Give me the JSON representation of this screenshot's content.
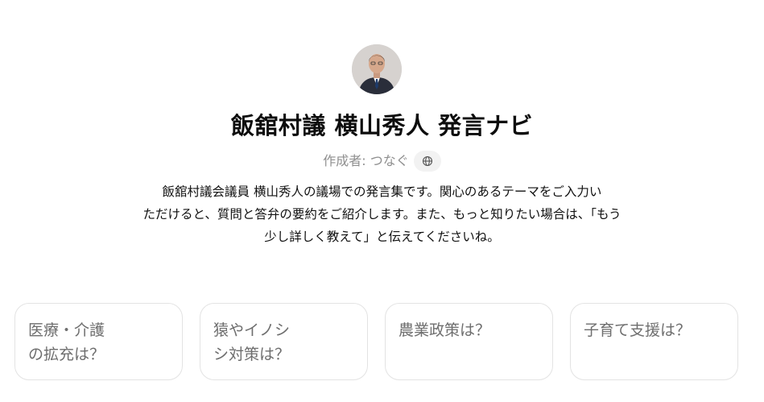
{
  "header": {
    "title": "飯舘村議 横山秀人 発言ナビ",
    "author": "作成者: つなぐ",
    "globe_icon": "globe-icon"
  },
  "description": {
    "lines": [
      "飯舘村議会議員 横山秀人の議場での発言集です。関心のあるテーマをご入力い",
      "ただけると、質問と答弁の要約をご紹介します。また、もっと知りたい場合は、「もう",
      "少し詳しく教えて」と伝えてくださいね。"
    ]
  },
  "suggestions": [
    {
      "lines": [
        "医療・介護",
        "の拡充は？"
      ]
    },
    {
      "lines": [
        "猿やイノシ",
        "シ対策は？"
      ]
    },
    {
      "lines": [
        "農業政策は？"
      ]
    },
    {
      "lines": [
        "子育て支援は？"
      ]
    }
  ],
  "colors": {
    "text": "#0d0d0d",
    "muted": "#8f8f8f",
    "card_border": "#e3e3e3",
    "card_text": "#6e6e6e",
    "chip_bg": "#f2f2f2"
  }
}
